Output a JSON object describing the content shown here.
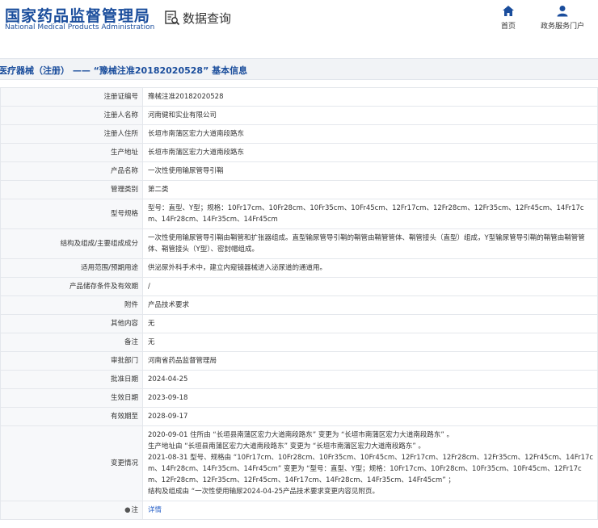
{
  "header": {
    "logo_cn": "国家药品监督管理局",
    "logo_en": "National Medical Products Administration",
    "search_title": "数据查询",
    "nav": [
      {
        "label": "首页",
        "icon": "home-icon"
      },
      {
        "label": "政务服务门户",
        "icon": "user-icon"
      }
    ]
  },
  "page": {
    "title": "医疗器械（注册） —— “豫械注准20182020528” 基本信息"
  },
  "colors": {
    "brand": "#1a4d9c",
    "link": "#2b63c8",
    "label_bg": "#f7f8fa",
    "border": "#e4e7ec"
  },
  "rows": [
    {
      "label": "注册证编号",
      "value": "豫械注准20182020528"
    },
    {
      "label": "注册人名称",
      "value": "河南健和实业有限公司"
    },
    {
      "label": "注册人住所",
      "value": "长垣市南蒲区宏力大道南段路东"
    },
    {
      "label": "生产地址",
      "value": "长垣市南蒲区宏力大道南段路东"
    },
    {
      "label": "产品名称",
      "value": "一次性使用输尿管导引鞘"
    },
    {
      "label": "管理类别",
      "value": "第二类"
    },
    {
      "label": "型号规格",
      "value": "型号：直型、Y型；规格：10Fr17cm、10Fr28cm、10Fr35cm、10Fr45cm、12Fr17cm、12Fr28cm、12Fr35cm、12Fr45cm、14Fr17cm、14Fr28cm、14Fr35cm、14Fr45cm"
    },
    {
      "label": "结构及组成/主要组成成分",
      "value": "一次性使用输尿管导引鞘由鞘管和扩张器组成。直型输尿管导引鞘的鞘管由鞘管管体、鞘管接头（直型）组成，Y型输尿管导引鞘的鞘管由鞘管管体、鞘管接头（Y型）、密封帽组成。"
    },
    {
      "label": "适用范围/预期用途",
      "value": "供泌尿外科手术中，建立内窥镜器械进入泌尿道的通道用。"
    },
    {
      "label": "产品储存条件及有效期",
      "value": "/"
    },
    {
      "label": "附件",
      "value": "产品技术要求"
    },
    {
      "label": "其他内容",
      "value": "无"
    },
    {
      "label": "备注",
      "value": "无"
    },
    {
      "label": "审批部门",
      "value": "河南省药品监督管理局"
    },
    {
      "label": "批准日期",
      "value": "2024-04-25"
    },
    {
      "label": "生效日期",
      "value": "2023-09-18"
    },
    {
      "label": "有效期至",
      "value": "2028-09-17"
    },
    {
      "label": "变更情况",
      "value": "2020-09-01 住所由 “长垣县南蒲区宏力大道南段路东” 变更为 “长垣市南蒲区宏力大道南段路东” 。\n生产地址由 “长垣县南蒲区宏力大道南段路东” 变更为 “长垣市南蒲区宏力大道南段路东” 。\n2021-08-31 型号、规格由 “10Fr17cm、10Fr28cm、10Fr35cm、10Fr45cm、12Fr17cm、12Fr28cm、12Fr35cm、12Fr45cm、14Fr17cm、14Fr28cm、14Fr35cm、14Fr45cm” 变更为 “型号：直型、Y型；规格：10Fr17cm、10Fr28cm、10Fr35cm、10Fr45cm、12Fr17cm、12Fr28cm、12Fr35cm、12Fr45cm、14Fr17cm、14Fr28cm、14Fr35cm、14Fr45cm” ；\n结构及组成由 “一次性使用输尿2024-04-25产品技术要求变更内容见附页。"
    }
  ],
  "detail": {
    "label": "注",
    "icon": "info-icon",
    "link": "详情"
  }
}
